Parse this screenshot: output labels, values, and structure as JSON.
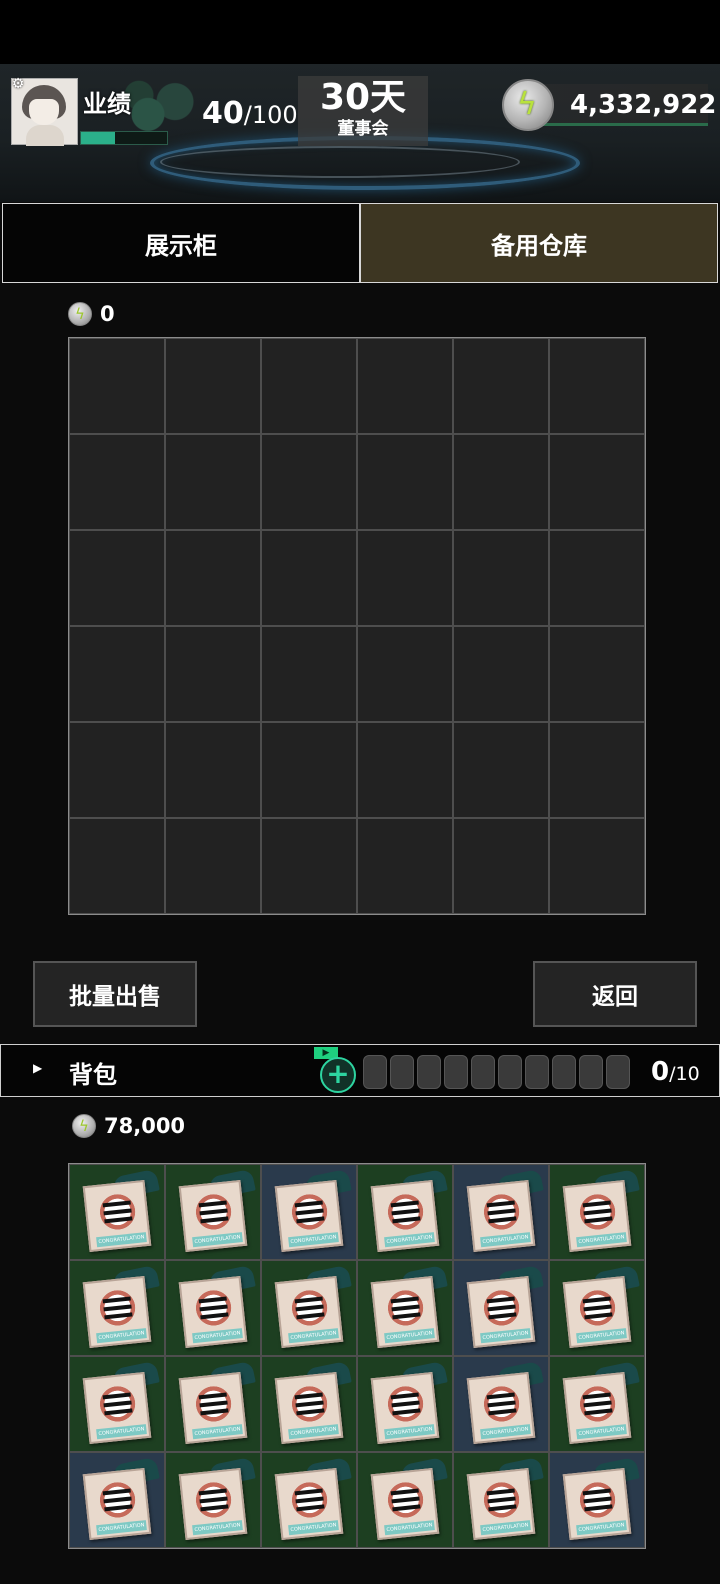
{
  "header": {
    "performance_label": "业绩",
    "performance_current": "40",
    "performance_max": "/100",
    "performance_progress": 0.4,
    "days_value": "30天",
    "days_label": "董事会",
    "money": "4,332,922"
  },
  "tabs": [
    {
      "label": "展示柜",
      "active": false
    },
    {
      "label": "备用仓库",
      "active": true
    }
  ],
  "storage": {
    "total_value": "0",
    "rows": 6,
    "cols": 6,
    "items": []
  },
  "buttons": {
    "bulk_sell": "批量出售",
    "back": "返回"
  },
  "backpack": {
    "title": "背包",
    "ad_label": "▶",
    "add_symbol": "+",
    "slot_count_current": "0",
    "slot_count_max": "/10",
    "total_value": "78,000",
    "item_ribbon_text": "CONGRATULATION",
    "cells": [
      [
        "green",
        "green",
        "blue",
        "green",
        "blue",
        "green"
      ],
      [
        "green",
        "green",
        "green",
        "green",
        "blue",
        "green"
      ],
      [
        "green",
        "green",
        "green",
        "green",
        "blue",
        "green"
      ],
      [
        "blue",
        "green",
        "green",
        "green",
        "green",
        "blue"
      ]
    ]
  },
  "colors": {
    "accent_green": "#2bb08a",
    "tab_active": "#3d3622",
    "cell_green": "#1d3f21",
    "cell_blue": "#2a3a4c"
  },
  "icons": {
    "coin": "lightning-coin-icon",
    "settings": "gear-icon",
    "expand": "triangle-right-icon",
    "add": "plus-icon"
  }
}
